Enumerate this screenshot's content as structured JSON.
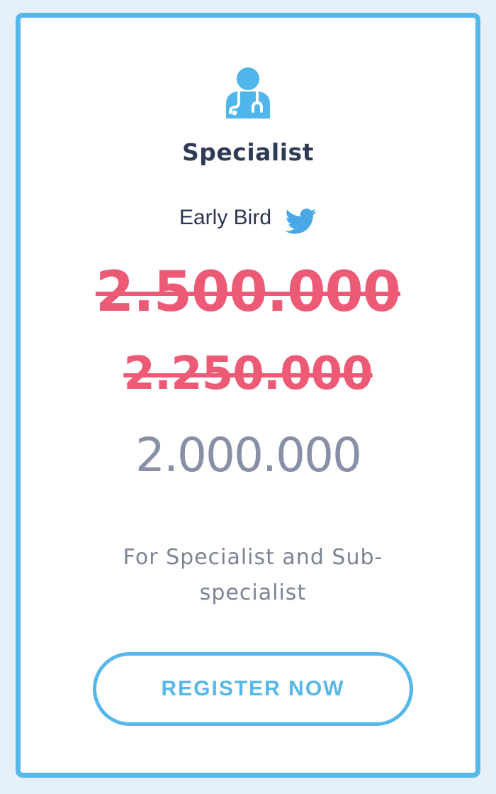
{
  "plan": {
    "icon": "doctor-stethoscope-icon",
    "title": "Specialist",
    "early_label": "Early Bird",
    "early_icon": "twitter-bird-icon"
  },
  "pricing": {
    "original_price": "2.500.000",
    "previous_price": "2.250.000",
    "current_price": "2.000.000"
  },
  "description": "For Specialist and Sub-specialist",
  "cta": {
    "label": "REGISTER NOW"
  },
  "colors": {
    "accent": "#55b7ea",
    "strike_price": "#ec5a76",
    "current_price": "#8790a6",
    "title": "#2f3a55",
    "background": "#e6f0f8"
  }
}
